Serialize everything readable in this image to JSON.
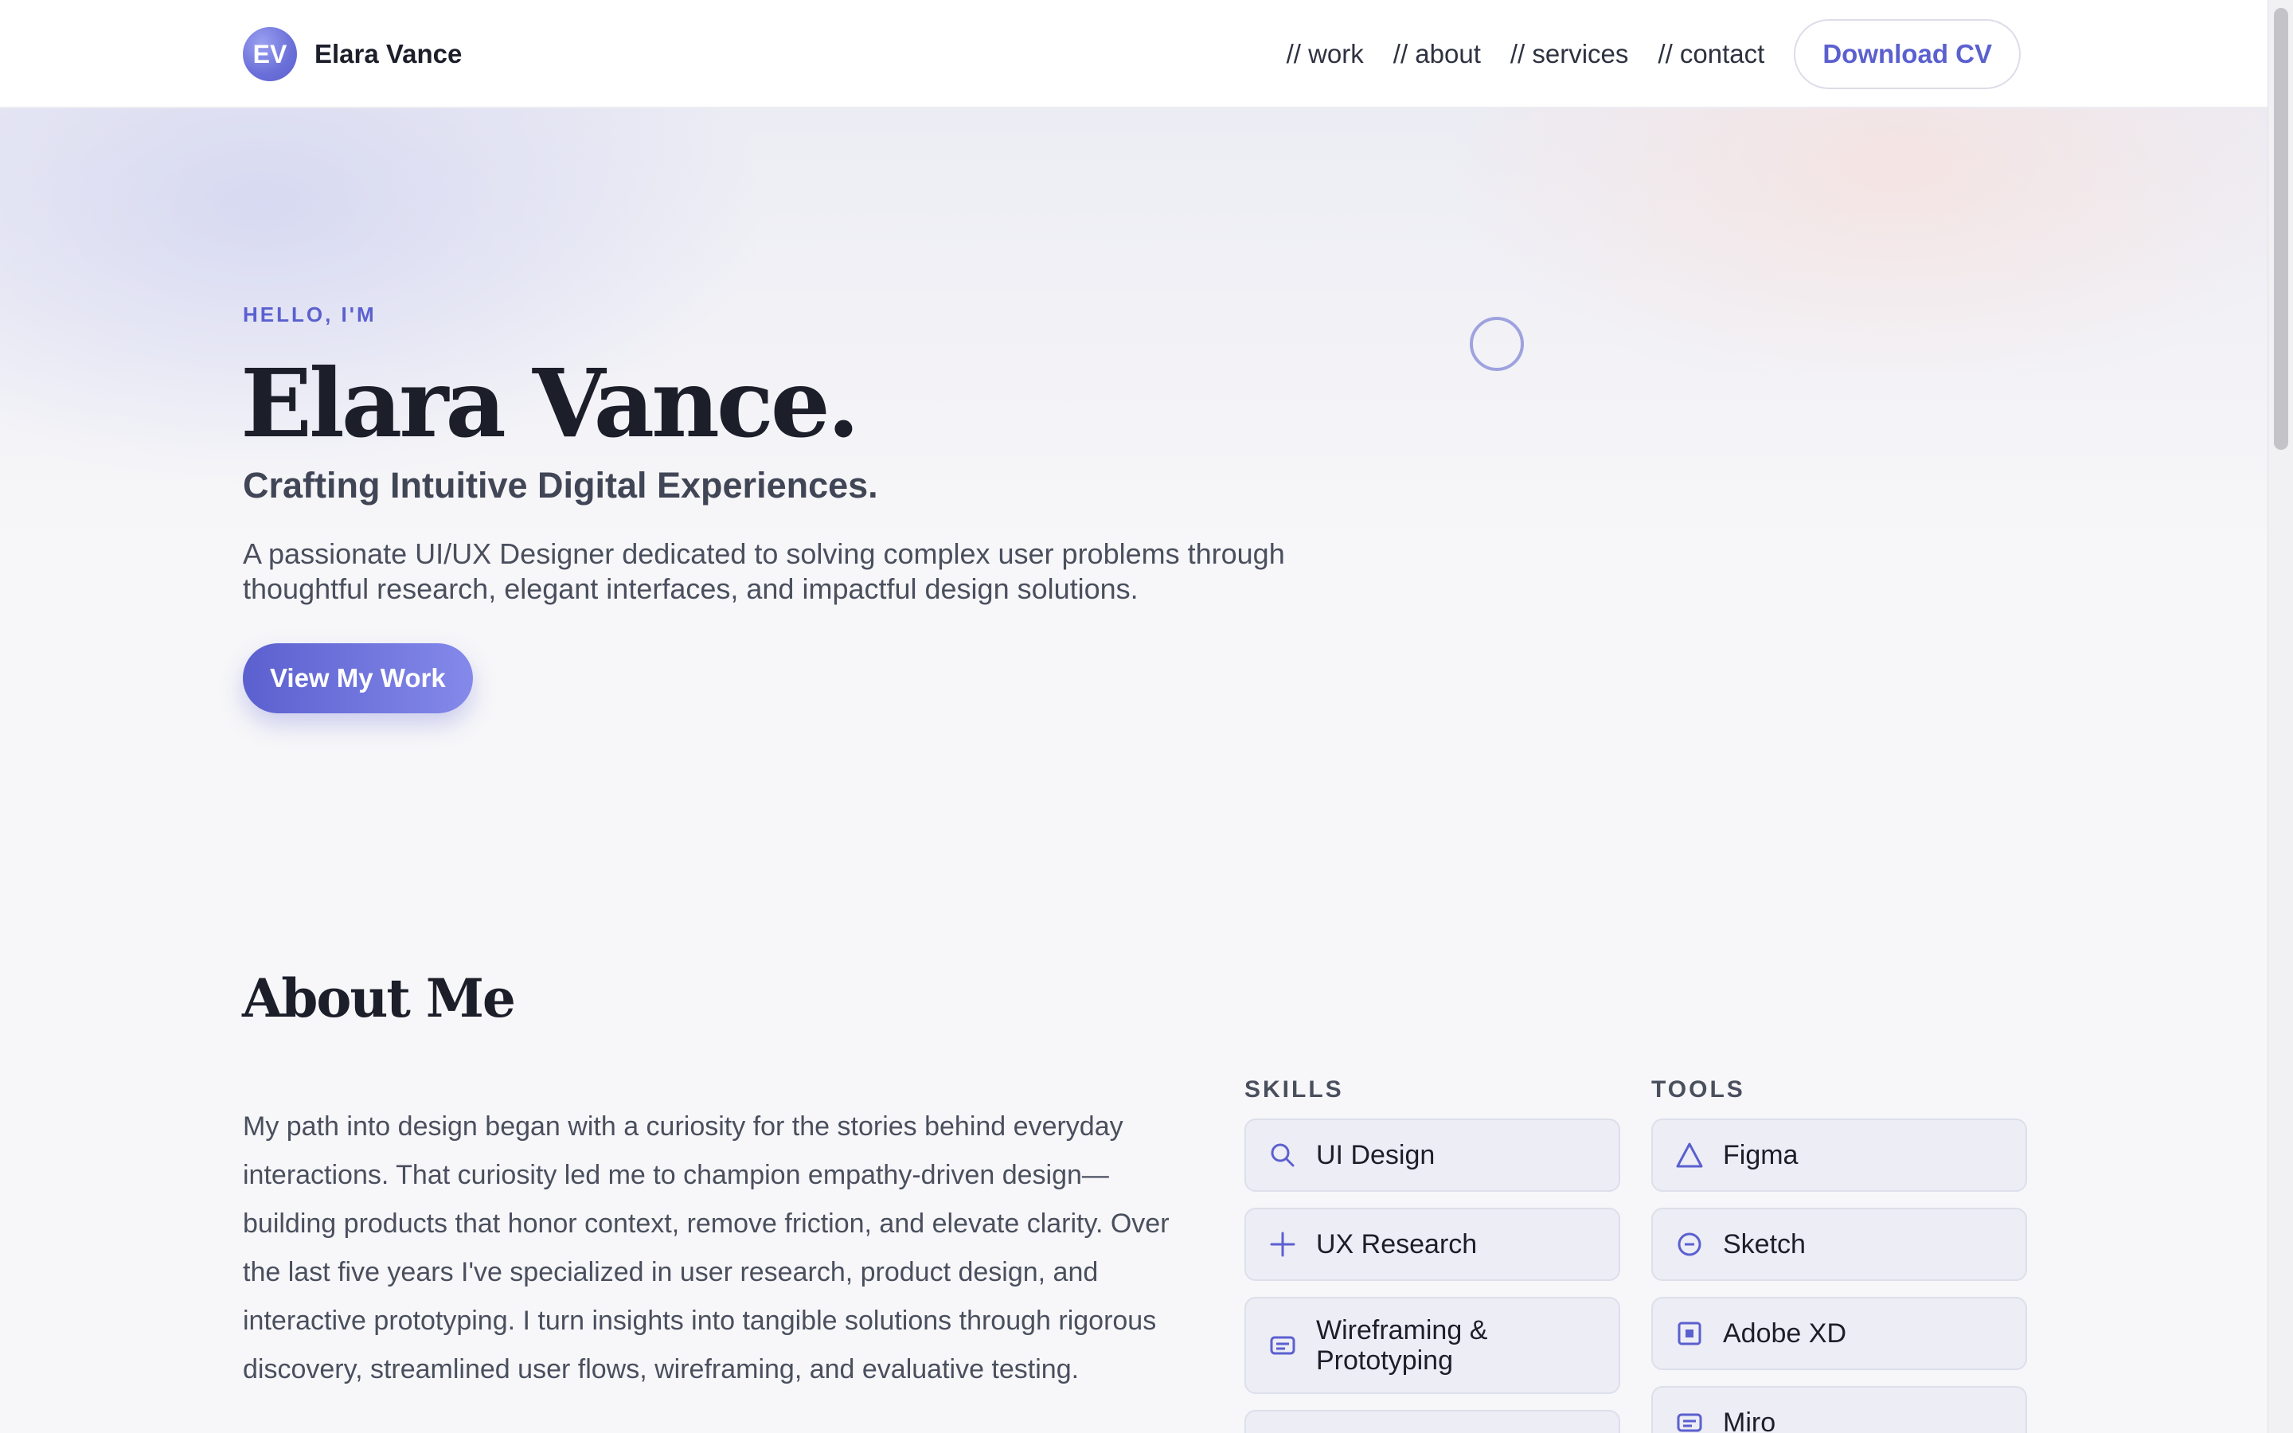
{
  "header": {
    "logo_initials": "EV",
    "brand_name": "Elara Vance",
    "nav": [
      "// work",
      "// about",
      "// services",
      "// contact"
    ],
    "cta": "Download CV"
  },
  "hero": {
    "eyebrow": "HELLO, I'M",
    "name": "Elara Vance.",
    "tagline": "Crafting Intuitive Digital Experiences.",
    "description_line1": "A passionate UI/UX Designer dedicated to solving complex user problems through",
    "description_line2": "thoughtful research, elegant interfaces, and impactful design solutions.",
    "button": "View My Work"
  },
  "about": {
    "title": "About Me",
    "text": "My path into design began with a curiosity for the stories behind everyday interactions. That curiosity led me to champion empathy-driven design—building products that honor context, remove friction, and elevate clarity. Over the last five years I've specialized in user research, product design, and interactive prototyping. I turn insights into tangible solutions through rigorous discovery, streamlined user flows, wireframing, and evaluative testing.",
    "skills_heading": "SKILLS",
    "tools_heading": "TOOLS",
    "skills": [
      {
        "label": "UI Design",
        "icon": "search-icon"
      },
      {
        "label": "UX Research",
        "icon": "plus-icon"
      },
      {
        "label_line1": "Wireframing &",
        "label_line2": "Prototyping",
        "icon": "message-icon"
      }
    ],
    "tools": [
      {
        "label": "Figma",
        "icon": "triangle-icon"
      },
      {
        "label": "Sketch",
        "icon": "minus-circle-icon"
      },
      {
        "label": "Adobe XD",
        "icon": "square-dot-icon"
      },
      {
        "label": "Miro",
        "icon": "message-icon"
      }
    ]
  },
  "colors": {
    "accent": "#5b60cf",
    "accent_light": "#8489ea",
    "text_dark": "#1c1f2a",
    "text_muted": "#4a4f5e",
    "chip_bg": "#ededf5"
  }
}
